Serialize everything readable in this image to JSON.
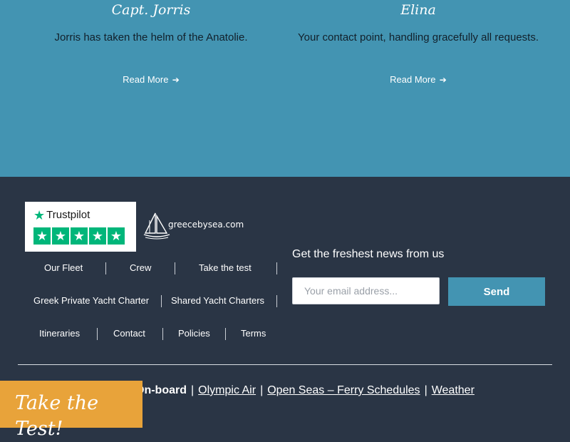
{
  "crew": [
    {
      "name": "Capt. Jorris",
      "description": "Jorris has taken the helm of the Anatolie.",
      "read_more": "Read More"
    },
    {
      "name": "Elina",
      "description": "Your contact point, handling gracefully all requests.",
      "read_more": "Read More"
    }
  ],
  "footer": {
    "trustpilot": {
      "label": "Trustpilot",
      "stars": 5,
      "star_color": "#00b67a"
    },
    "brand_logo": "greecebysea.com",
    "nav": [
      {
        "label": "Our Fleet"
      },
      {
        "label": "Crew"
      },
      {
        "label": "Take the test"
      },
      {
        "label": "Greek Private Yacht Charter"
      },
      {
        "label": "Shared Yacht Charters"
      },
      {
        "label": "Itineraries"
      },
      {
        "label": "Contact"
      },
      {
        "label": "Policies"
      },
      {
        "label": "Terms"
      }
    ],
    "newsletter": {
      "heading": "Get the freshest news from us",
      "placeholder": "Your email address...",
      "button": "Send"
    },
    "bottom_links": {
      "onboard": "On-board",
      "links": [
        "Olympic Air",
        "Open Seas – Ferry Schedules",
        "Weather"
      ]
    }
  },
  "take_test_button": "Take the Test!",
  "colors": {
    "top_bg": "#4394b2",
    "footer_bg": "#2a3545",
    "accent": "#4394b2",
    "cta": "#e8a33a"
  }
}
